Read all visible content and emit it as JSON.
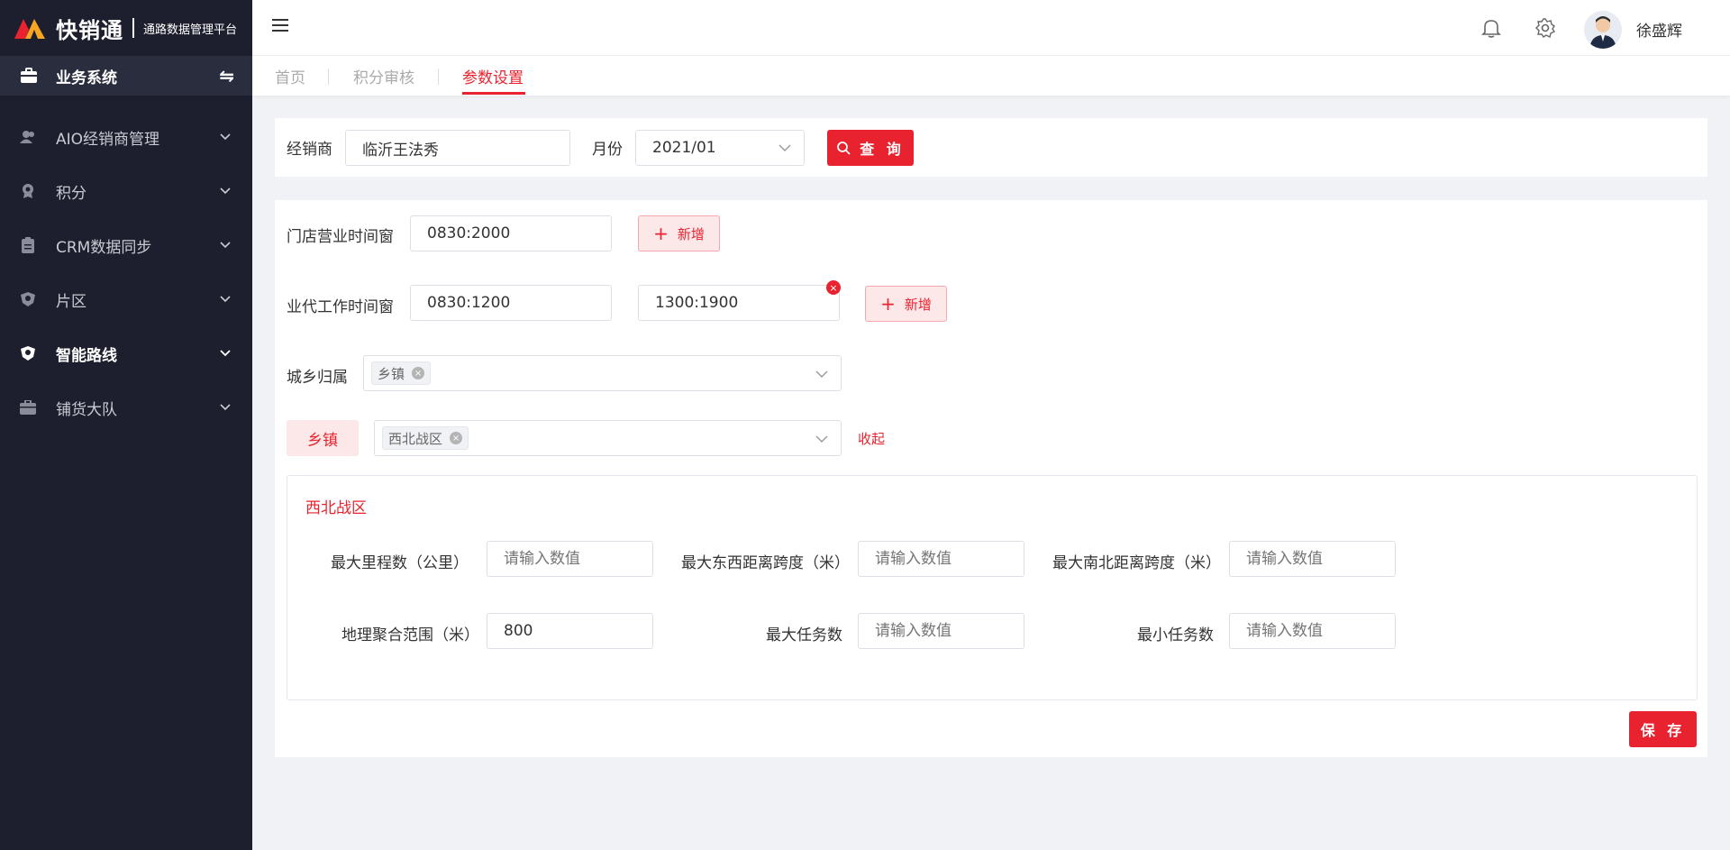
{
  "brand": {
    "name": "快销通",
    "subtitle": "通路数据管理平台"
  },
  "system": {
    "label": "业务系统"
  },
  "menu": [
    {
      "label": "AIO经销商管理",
      "icon": "users-icon"
    },
    {
      "label": "积分",
      "icon": "medal-icon"
    },
    {
      "label": "CRM数据同步",
      "icon": "clipboard-icon"
    },
    {
      "label": "片区",
      "icon": "shield-icon"
    },
    {
      "label": "智能路线",
      "icon": "shield-active-icon",
      "active": true
    },
    {
      "label": "铺货大队",
      "icon": "briefcase-icon"
    }
  ],
  "header": {
    "username": "徐盛辉"
  },
  "tabs": [
    {
      "label": "首页"
    },
    {
      "label": "积分审核"
    },
    {
      "label": "参数设置",
      "active": true
    }
  ],
  "filter": {
    "dealer_label": "经销商",
    "dealer_value": "临沂王法秀",
    "month_label": "月份",
    "month_value": "2021/01",
    "query_label": "查 询"
  },
  "settings": {
    "store_hours_label": "门店营业时间窗",
    "store_hours": [
      "0830:2000"
    ],
    "agent_hours_label": "业代工作时间窗",
    "agent_hours": [
      "0830:1200",
      "1300:1900"
    ],
    "add_label": "新增",
    "urban_rural_label": "城乡归属",
    "urban_rural_tags": [
      "乡镇"
    ],
    "town_label": "乡镇",
    "town_tags": [
      "西北战区"
    ],
    "collapse_label": "收起"
  },
  "region": {
    "title": "西北战区",
    "fields": [
      {
        "label": "最大里程数（公里）",
        "value": "",
        "placeholder": "请输入数值"
      },
      {
        "label": "最大东西距离跨度（米）",
        "value": "",
        "placeholder": "请输入数值"
      },
      {
        "label": "最大南北距离跨度（米）",
        "value": "",
        "placeholder": "请输入数值"
      },
      {
        "label": "地理聚合范围（米）",
        "value": "800",
        "placeholder": ""
      },
      {
        "label": "最大任务数",
        "value": "",
        "placeholder": "请输入数值"
      },
      {
        "label": "最小任务数",
        "value": "",
        "placeholder": "请输入数值"
      }
    ]
  },
  "save_label": "保 存",
  "colors": {
    "accent": "#e8232f",
    "sidebar": "#1d1f2e"
  }
}
